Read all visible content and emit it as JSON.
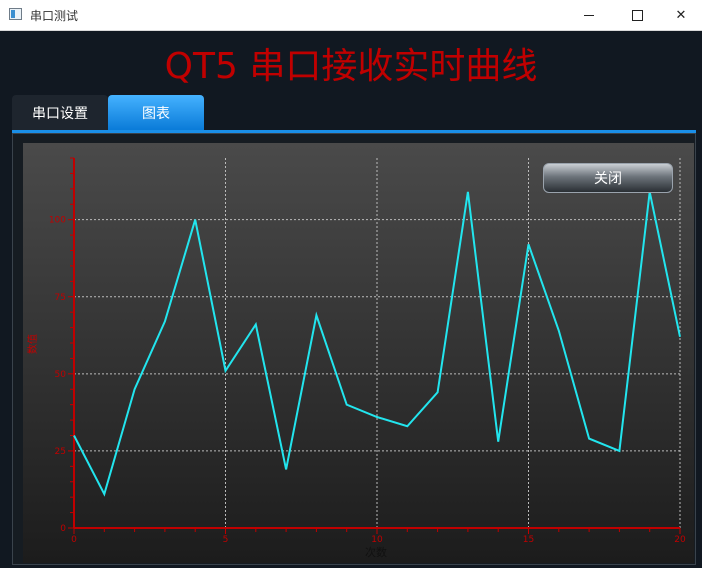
{
  "window": {
    "title": "串口测试",
    "minimize_icon": "minimize-icon",
    "maximize_icon": "maximize-icon",
    "close_symbol": "✕"
  },
  "header": {
    "title": "QT5 串口接收实时曲线"
  },
  "tabs": [
    {
      "label": "串口设置",
      "active": false
    },
    {
      "label": "图表",
      "active": true
    }
  ],
  "chart_panel": {
    "close_button_label": "关闭"
  },
  "colors": {
    "accent": "#1a8fe8",
    "title_red": "#c00000",
    "series_line": "#22e5ee",
    "axis_red": "#c00000"
  },
  "chart_data": {
    "type": "line",
    "title": "",
    "xlabel": "次数",
    "ylabel": "数值",
    "xlim": [
      0,
      20
    ],
    "ylim": [
      0,
      120
    ],
    "x_ticks": [
      "0",
      "5",
      "10",
      "15",
      "20"
    ],
    "y_ticks": [
      "0",
      "25",
      "50",
      "75",
      "100"
    ],
    "grid": true,
    "series": [
      {
        "color": "#22e5ee",
        "x": [
          0,
          1,
          2,
          3,
          4,
          5,
          6,
          7,
          8,
          9,
          10,
          11,
          12,
          13,
          14,
          15,
          16,
          17,
          18,
          19,
          20
        ],
        "y": [
          30,
          11,
          45,
          67,
          100,
          51,
          66,
          19,
          69,
          40,
          36,
          33,
          44,
          109,
          28,
          92,
          64,
          29,
          25,
          109,
          62
        ]
      }
    ]
  }
}
